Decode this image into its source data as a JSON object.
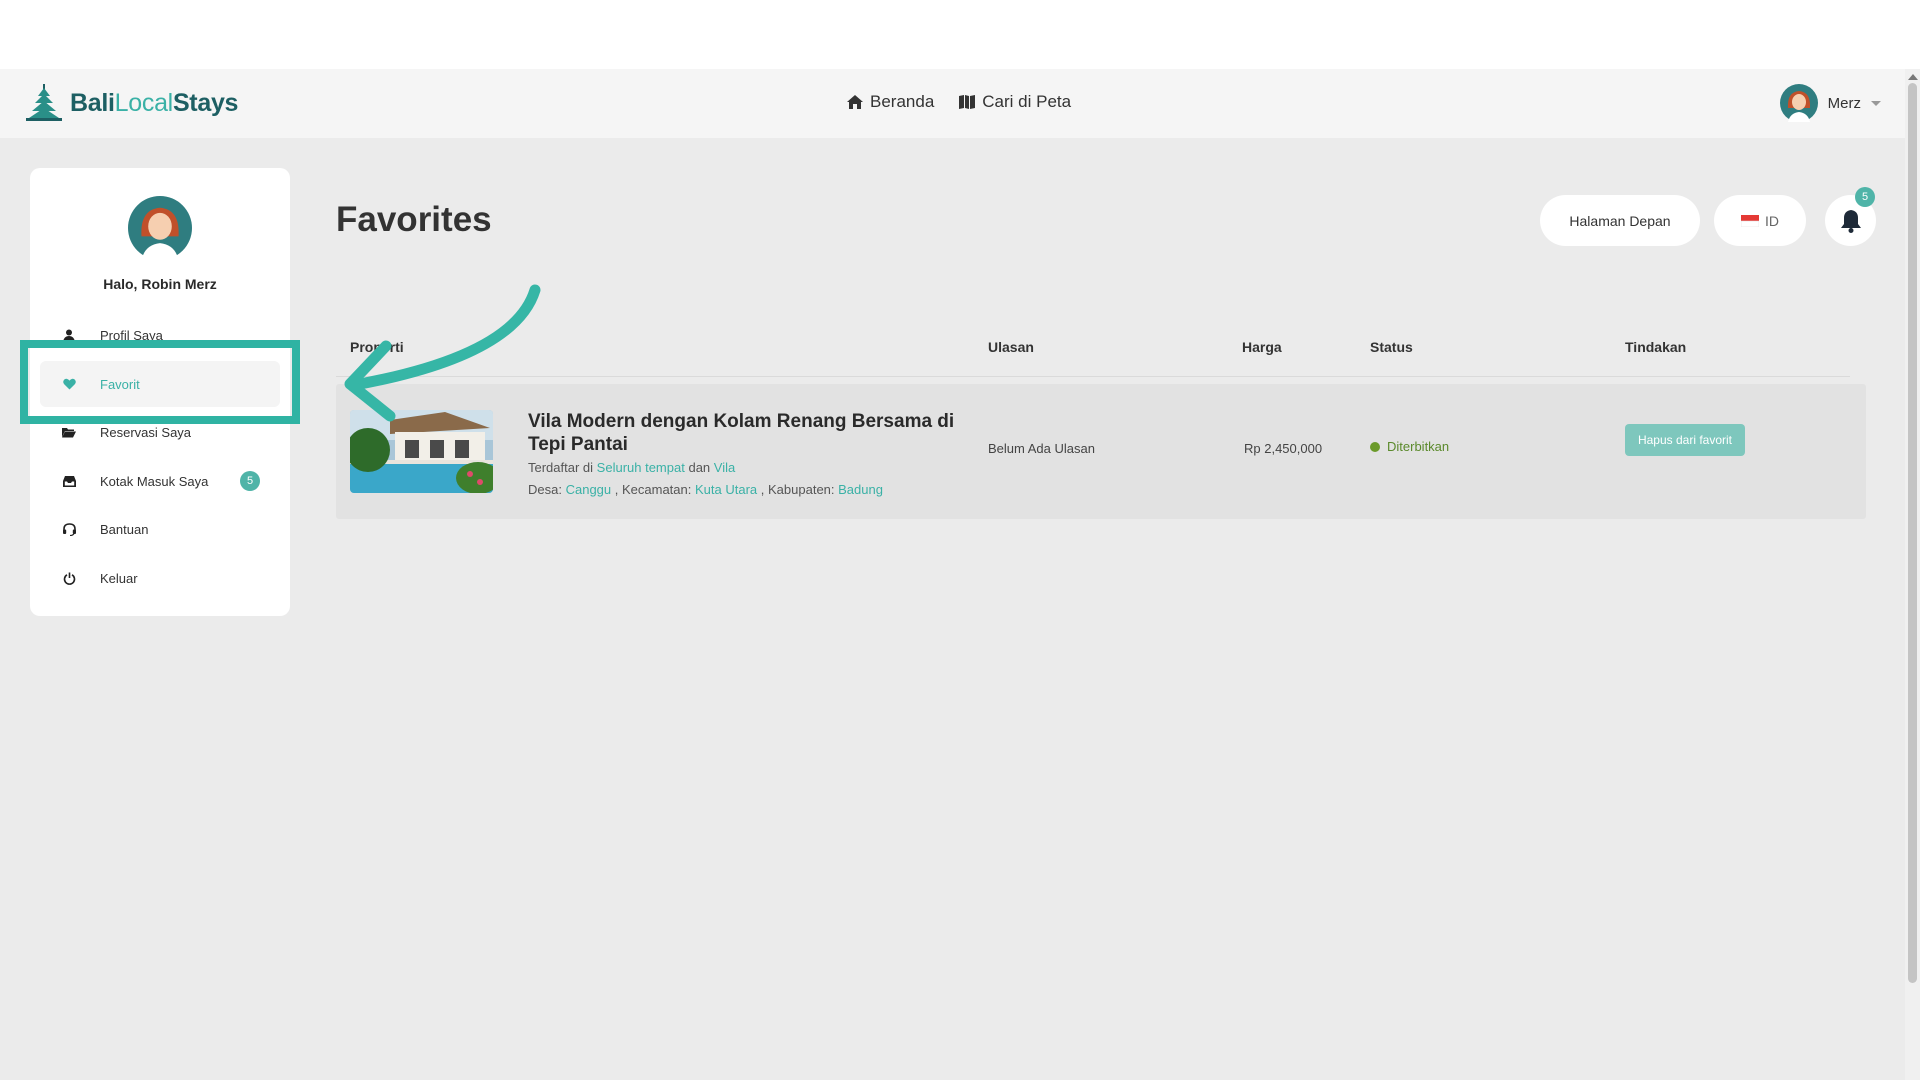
{
  "header": {
    "logo": {
      "part1": "Bali",
      "part2": "Local",
      "part3": "Stays"
    },
    "nav": [
      {
        "label": "Beranda",
        "icon": "home-icon"
      },
      {
        "label": "Cari di Peta",
        "icon": "map-icon"
      }
    ],
    "user_name": "Merz"
  },
  "sidebar": {
    "greeting": "Halo, Robin Merz",
    "items": [
      {
        "label": "Profil Saya",
        "icon": "user-icon"
      },
      {
        "label": "Favorit",
        "icon": "heart-icon"
      },
      {
        "label": "Reservasi Saya",
        "icon": "folder-icon"
      },
      {
        "label": "Kotak Masuk Saya",
        "icon": "inbox-icon",
        "badge": "5"
      },
      {
        "label": "Bantuan",
        "icon": "headset-icon"
      },
      {
        "label": "Keluar",
        "icon": "power-icon"
      }
    ]
  },
  "main": {
    "title": "Favorites",
    "home_button": "Halaman Depan",
    "language": "ID",
    "notification_count": "5",
    "table": {
      "headers": [
        "Properti",
        "Ulasan",
        "Harga",
        "Status",
        "Tindakan"
      ],
      "rows": [
        {
          "title": "Vila Modern dengan Kolam Renang Bersama di Tepi Pantai",
          "listed_prefix": "Terdaftar di",
          "listed_place": "Seluruh tempat",
          "listed_join": "dan",
          "listed_type": "Vila",
          "desa_label": "Desa:",
          "desa": "Canggu",
          "kecamatan_label": ", Kecamatan:",
          "kecamatan": "Kuta Utara",
          "kabupaten_label": ", Kabupaten:",
          "kabupaten": "Badung",
          "review": "Belum Ada Ulasan",
          "price": "Rp 2,450,000",
          "status": "Diterbitkan",
          "action": "Hapus dari favorit"
        }
      ]
    }
  },
  "colors": {
    "accent": "#3ab1a6",
    "highlight": "#2fb3a3",
    "status": "#6b9a2a"
  }
}
